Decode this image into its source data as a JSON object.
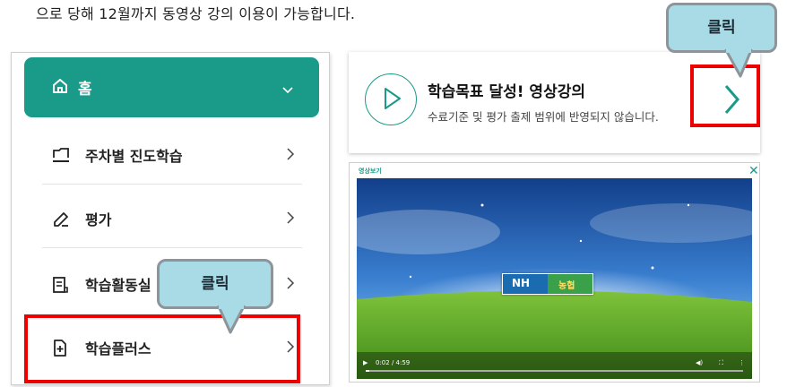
{
  "instruction_text": "으로 당해 12월까지 동영상 강의 이용이 가능합니다.",
  "menu": {
    "home_label": "홈",
    "items": [
      {
        "label": "주차별 진도학습",
        "icon": "folder-icon"
      },
      {
        "label": "평가",
        "icon": "pencil-icon"
      },
      {
        "label": "학습활동실",
        "icon": "document-icon"
      },
      {
        "label": "학습플러스",
        "icon": "file-plus-icon"
      }
    ]
  },
  "callouts": {
    "left": "클릭",
    "right": "클릭"
  },
  "goal_card": {
    "title": "학습목표 달성! 영상강의",
    "subtitle": "수료기준 및 평가 출제 범위에 반영되지 않습니다."
  },
  "video": {
    "title": "영상보기",
    "time": "0:02 / 4:59",
    "logo_left": "NH",
    "logo_right": "농협"
  },
  "colors": {
    "accent": "#1a9a88",
    "highlight": "#ee0000",
    "callout": "#a9dbe7"
  }
}
